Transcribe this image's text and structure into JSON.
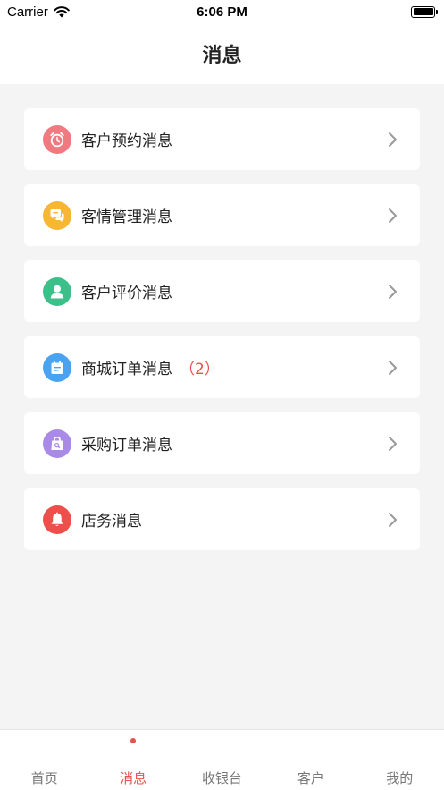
{
  "status_bar": {
    "carrier": "Carrier",
    "time": "6:06 PM",
    "battery_level": 1.0
  },
  "nav": {
    "title": "消息"
  },
  "messages": [
    {
      "label": "客户预约消息",
      "icon": "alarm-clock-icon",
      "color": "#f07a80",
      "count": ""
    },
    {
      "label": "客情管理消息",
      "icon": "chat-bubbles-icon",
      "color": "#f7b733",
      "count": ""
    },
    {
      "label": "客户评价消息",
      "icon": "person-icon",
      "color": "#3dbf8a",
      "count": ""
    },
    {
      "label": "商城订单消息",
      "icon": "calendar-order-icon",
      "color": "#4aa3f0",
      "count": "（2）"
    },
    {
      "label": "采购订单消息",
      "icon": "shopping-bag-icon",
      "color": "#a98ae6",
      "count": ""
    },
    {
      "label": "店务消息",
      "icon": "bell-icon",
      "color": "#ee4f4a",
      "count": ""
    }
  ],
  "tabs": [
    {
      "label": "首页",
      "active": false
    },
    {
      "label": "消息",
      "active": true
    },
    {
      "label": "收银台",
      "active": false
    },
    {
      "label": "客户",
      "active": false
    },
    {
      "label": "我的",
      "active": false
    }
  ],
  "colors": {
    "accent": "#e8504a",
    "background": "#f4f4f4",
    "card": "#ffffff",
    "chevron": "#999999"
  }
}
